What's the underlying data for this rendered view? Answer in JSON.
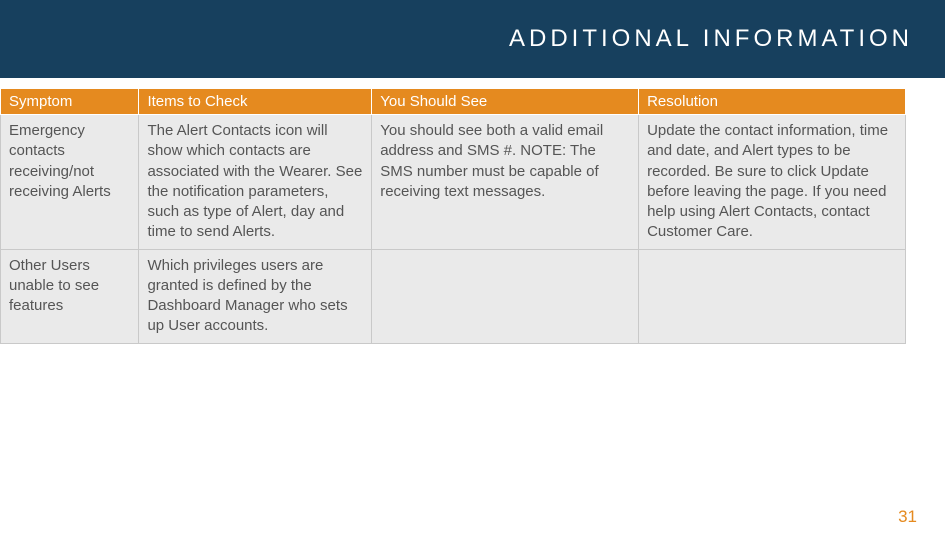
{
  "header": {
    "title": "ADDITIONAL INFORMATION"
  },
  "table": {
    "headers": {
      "symptom": "Symptom",
      "items": "Items to Check",
      "see": "You Should See",
      "resolution": "Resolution"
    },
    "rows": [
      {
        "symptom": "Emergency contacts receiving/not receiving Alerts",
        "items": "The Alert Contacts icon will show which contacts are associated with the Wearer. See the notification parameters, such as type of Alert, day and time to send Alerts.",
        "see": "You should see both a valid email address and SMS #. NOTE: The SMS number must be capable of receiving text messages.",
        "resolution": "Update the contact information, time and date, and Alert types to be recorded. Be sure to click Update before leaving the page. If you need help using Alert Contacts, contact Customer Care."
      },
      {
        "symptom": "Other Users unable to see features",
        "items": "Which privileges users are granted is defined by the Dashboard Manager who sets up User accounts.",
        "see": "",
        "resolution": ""
      }
    ]
  },
  "page_number": "31"
}
